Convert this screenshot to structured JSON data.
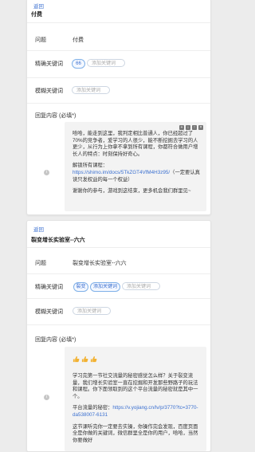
{
  "card1": {
    "back": "返回",
    "title": "付费",
    "question_label": "问题",
    "question_value": "付费",
    "exact_label": "精确关键词",
    "exact_tags": [
      "66"
    ],
    "exact_placeholder": "添加关键词",
    "fuzzy_label": "模糊关键词",
    "fuzzy_placeholder": "添加关键词",
    "reply_label": "回复内容 (必填*)",
    "reply": {
      "p1": "哈哈，能走到这里，我判定相比普通人，你已经超过了70%的竞争者，爱学习的人很少，能不断挖掘去学习的人更少，从行为上你拿不拿到所有课程，你都符合做用户增长人的特点：时刻保持好奇心。",
      "p2_text": "解锁所有课程：",
      "p2_link": "https://shimo.im/docs/5TkZGT4VfM4H3z95/",
      "p2_tail": "（一定要认真读只发权益的每一个权益）",
      "p3": "谢谢你的参与，游戏到这结束，更多机会我们群里见~"
    },
    "tools": [
      "+",
      "↓",
      "↑",
      "×"
    ]
  },
  "card2": {
    "back": "返回",
    "title": "裂变增长实验室--六六",
    "question_label": "问题",
    "question_value": "裂变增长实验室--六六",
    "exact_label": "精确关键词",
    "exact_tags": [
      "裂变",
      "添加关键词"
    ],
    "exact_placeholder": "添加关键词",
    "fuzzy_label": "模糊关键词",
    "fuzzy_placeholder": "添加关键词",
    "reply_label": "回复内容 (必填*)",
    "reply": {
      "p1": "学习完第一节社交流量的秘密感觉怎么样？关于裂变流量，我们增长实验室一直在挖掘和开发那些野路子的玩法和课程。你下面领取到的这个平台流量的秘密就是其中一个。",
      "p2_text": "平台流量的秘密：",
      "p2_link": "https://v.yojiang.cn/lv/p/3770?tc=3770-da538007-6131",
      "p3": "这节课听完你一定要去实操，你操作完会发现，百度页面全是你做的关键词，微信群里全是你的用户，哈哈，当然你要做好"
    }
  },
  "colors": {
    "link": "#3a6fd0",
    "tag_border": "#7fb0e8",
    "thumb": "#f2b233"
  },
  "icons": {
    "info": "info-icon",
    "thumb": "thumbs-up-icon"
  }
}
